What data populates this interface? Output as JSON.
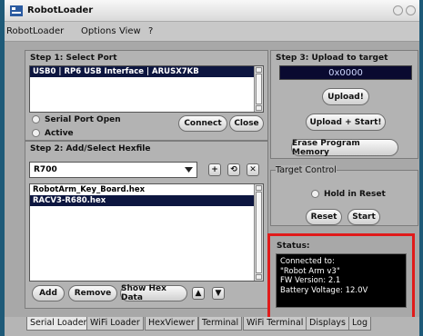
{
  "window": {
    "title": "RobotLoader"
  },
  "menu": {
    "items": [
      "RobotLoader",
      "Options",
      "View",
      "?"
    ]
  },
  "step1": {
    "title": "Step 1: Select Port",
    "ports": [
      "USB0 | RP6 USB Interface | ARUSX7KB"
    ],
    "status_label": "Serial Port Open",
    "active_label": "Active",
    "connect_label": "Connect",
    "close_label": "Close"
  },
  "step2": {
    "title": "Step 2: Add/Select Hexfile",
    "device": "R700",
    "files": [
      "RobotArm_Key_Board.hex",
      "RACV3-R680.hex"
    ],
    "add_label": "Add",
    "remove_label": "Remove",
    "showhex_label": "Show Hex Data"
  },
  "step3": {
    "title": "Step 3: Upload to target",
    "address": "0x0000",
    "upload_label": "Upload!",
    "upload_start_label": "Upload + Start!",
    "erase_label": "Erase Program Memory"
  },
  "target": {
    "title": "Target Control",
    "hold_label": "Hold in Reset",
    "reset_label": "Reset",
    "start_label": "Start"
  },
  "status": {
    "title": "Status:",
    "lines": [
      "Connected to:",
      "\"Robot Arm v3\"",
      "FW Version: 2.1",
      "Battery Voltage: 12.0V"
    ]
  },
  "tabs": [
    "Serial Loader",
    "WiFi Loader",
    "HexViewer",
    "Terminal",
    "WiFi Terminal",
    "Displays",
    "Log"
  ],
  "colors": {
    "highlight_box": "#e01b1b",
    "selection": "#0d1640"
  }
}
